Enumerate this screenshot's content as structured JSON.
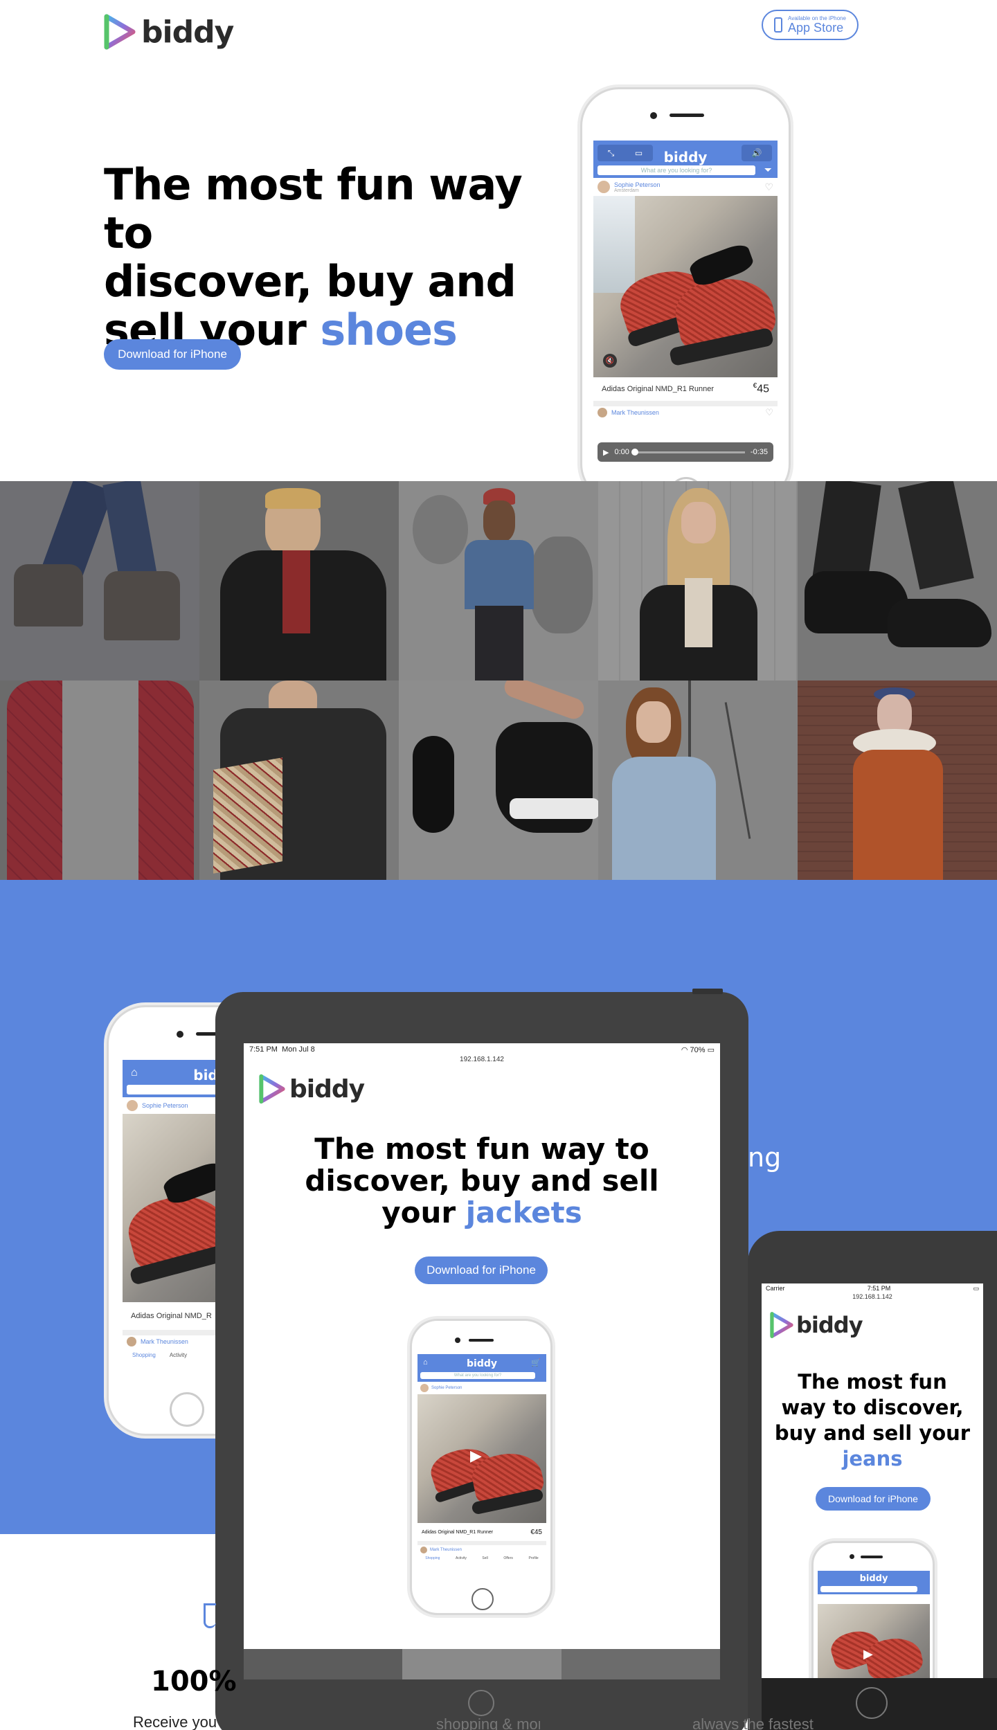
{
  "header": {
    "logo_text": "biddy",
    "appstore_small": "Available on the iPhone",
    "appstore_big": "App Store"
  },
  "hero": {
    "title_lines": [
      "The most fun way to",
      "discover, buy and",
      "sell your "
    ],
    "title_accent": "shoes",
    "cta": "Download for iPhone"
  },
  "hero_phone": {
    "brand": "biddy",
    "search_placeholder": "What are you looking for?",
    "seller1_name": "Sophie Peterson",
    "seller1_location": "Amsterdam",
    "item_name": "Adidas Original NMD_R1 Runner",
    "item_currency": "€",
    "item_price": "45",
    "seller2_name": "Mark Theunissen",
    "audio_elapsed": "0:00",
    "audio_remaining": "-0:35",
    "audio_progress": 0.0
  },
  "blue_section": {
    "partial_text": "ng"
  },
  "left_phone": {
    "brand": "bid",
    "seller1_name": "Sophie Peterson",
    "item_name": "Adidas Original NMD_R",
    "seller2_name": "Mark Theunissen",
    "tabs": [
      "Shopping",
      "Activity"
    ]
  },
  "tablet": {
    "time": "7:51 PM",
    "date": "Mon Jul 8",
    "url": "192.168.1.142",
    "battery": "70%",
    "logo_text": "biddy",
    "title_lines": [
      "The most fun way to",
      "discover, buy and sell",
      "your "
    ],
    "title_accent": "jackets",
    "cta": "Download for iPhone",
    "inner_phone": {
      "brand": "biddy",
      "search_placeholder": "What are you looking for?",
      "seller1_name": "Sophie Peterson",
      "item_name": "Adidas Original NMD_R1 Runner",
      "item_currency": "€",
      "item_price": "45",
      "seller2_name": "Mark Theunissen",
      "tabs": [
        "Shopping",
        "Activity",
        "Sell",
        "Offers",
        "Profile"
      ]
    }
  },
  "right_phone": {
    "carrier": "Carrier",
    "time": "7:51 PM",
    "url": "192.168.1.142",
    "logo_text": "biddy",
    "title_lines": [
      "The most fun",
      "way to discover,",
      "buy and sell your"
    ],
    "title_accent": "jeans",
    "cta": "Download for iPhone",
    "inner_brand": "biddy"
  },
  "bottom": {
    "stat_partial": "100%",
    "desc_partial_1": "Receive your items on your",
    "desc_partial_2": "shopping & more",
    "desc_partial_3": "always the fastest"
  },
  "colors": {
    "accent": "#5b86dd",
    "dark": "#414141"
  }
}
